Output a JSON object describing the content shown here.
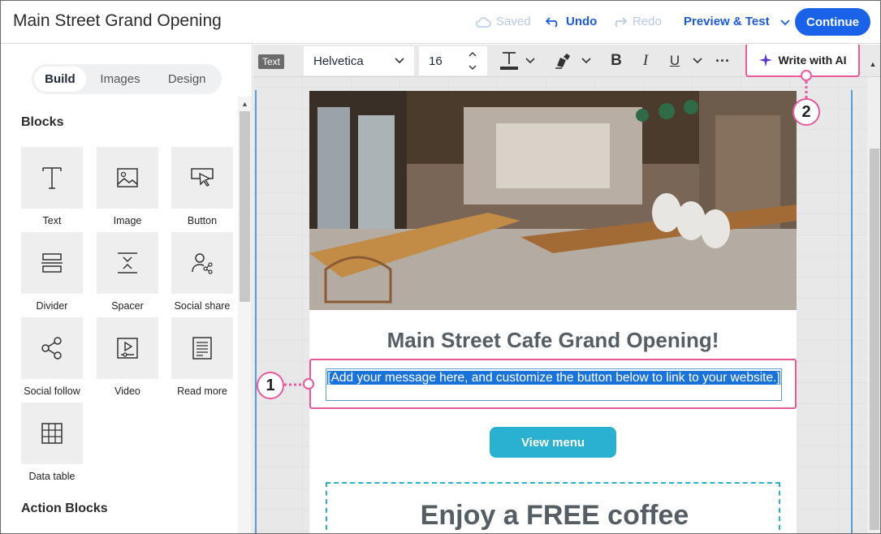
{
  "header": {
    "title": "Main Street Grand Opening",
    "saved": "Saved",
    "undo": "Undo",
    "redo": "Redo",
    "preview": "Preview & Test",
    "continue": "Continue"
  },
  "sidebar": {
    "tabs": [
      "Build",
      "Images",
      "Design"
    ],
    "blocks_title": "Blocks",
    "blocks": [
      {
        "label": "Text",
        "icon": "text-icon"
      },
      {
        "label": "Image",
        "icon": "image-icon"
      },
      {
        "label": "Button",
        "icon": "button-icon"
      },
      {
        "label": "Divider",
        "icon": "divider-icon"
      },
      {
        "label": "Spacer",
        "icon": "spacer-icon"
      },
      {
        "label": "Social share",
        "icon": "social-share-icon"
      },
      {
        "label": "Social follow",
        "icon": "social-follow-icon"
      },
      {
        "label": "Video",
        "icon": "video-icon"
      },
      {
        "label": "Read more",
        "icon": "read-more-icon"
      },
      {
        "label": "Data table",
        "icon": "data-table-icon"
      }
    ],
    "action_title": "Action Blocks"
  },
  "toolbar": {
    "badge": "Text",
    "font": "Helvetica",
    "size": "16",
    "write_ai": "Write with AI"
  },
  "email": {
    "heading": "Main Street Cafe Grand Opening!",
    "message": "[Add your message here, and customize the button below to link to your website.]",
    "button": "View menu",
    "coupon": "Enjoy a FREE coffee"
  },
  "callouts": [
    "1",
    "2"
  ],
  "colors": {
    "accent": "#1a63e8",
    "callout": "#e55b9c",
    "button": "#2ab0d0",
    "selection": "#1a73d9"
  }
}
